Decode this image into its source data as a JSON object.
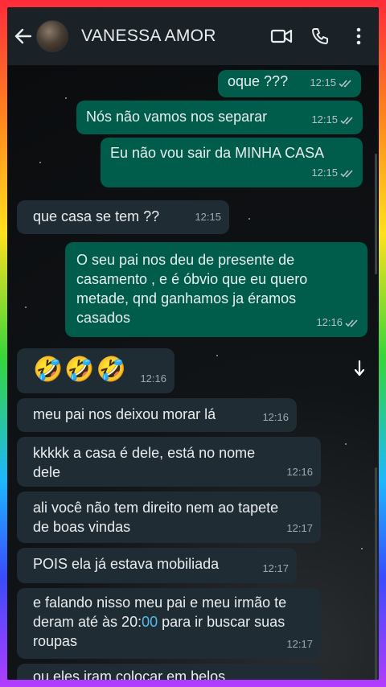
{
  "header": {
    "contact_name": "VANESSA AMOR",
    "icons": [
      "back-arrow-icon",
      "video-call-icon",
      "phone-icon",
      "more-vert-icon"
    ]
  },
  "colors": {
    "outgoing_bubble": "#005c4b",
    "incoming_bubble": "#202c33",
    "header": "#1b2227",
    "read_ticks": "#b8c2c6",
    "link_blue": "#53bdeb"
  },
  "messages": [
    {
      "dir": "out",
      "text": "oque ???",
      "time": "12:15",
      "read": true
    },
    {
      "dir": "out",
      "text": "Nós não vamos nos separar",
      "time": "12:15",
      "read": true
    },
    {
      "dir": "out",
      "text": "Eu não vou sair da MINHA CASA",
      "time": "12:15",
      "read": true
    },
    {
      "dir": "in",
      "text": "que casa se tem ??",
      "time": "12:15"
    },
    {
      "dir": "out",
      "text": "O seu pai nos deu de presente de casamento , e é óbvio que eu quero metade, qnd ganhamos ja éramos casados",
      "time": "12:16",
      "read": true
    },
    {
      "dir": "in",
      "text": "🤣🤣🤣",
      "time": "12:16"
    },
    {
      "dir": "in",
      "text": "meu pai nos deixou morar lá",
      "time": "12:16"
    },
    {
      "dir": "in",
      "text": "kkkkk a casa é dele, está no nome dele",
      "time": "12:16"
    },
    {
      "dir": "in",
      "text": "ali você não tem direito nem ao tapete de boas vindas",
      "time": "12:17"
    },
    {
      "dir": "in",
      "text": "POIS ela já estava mobiliada",
      "time": "12:17"
    },
    {
      "dir": "in",
      "text_before": "e falando nisso meu pai e meu irmão te deram até às 20:",
      "text_highlight": "00",
      "text_after": " para ir buscar suas roupas",
      "time": "12:17"
    },
    {
      "dir": "in",
      "text": "ou eles iram colocar em belos",
      "time": ""
    }
  ]
}
